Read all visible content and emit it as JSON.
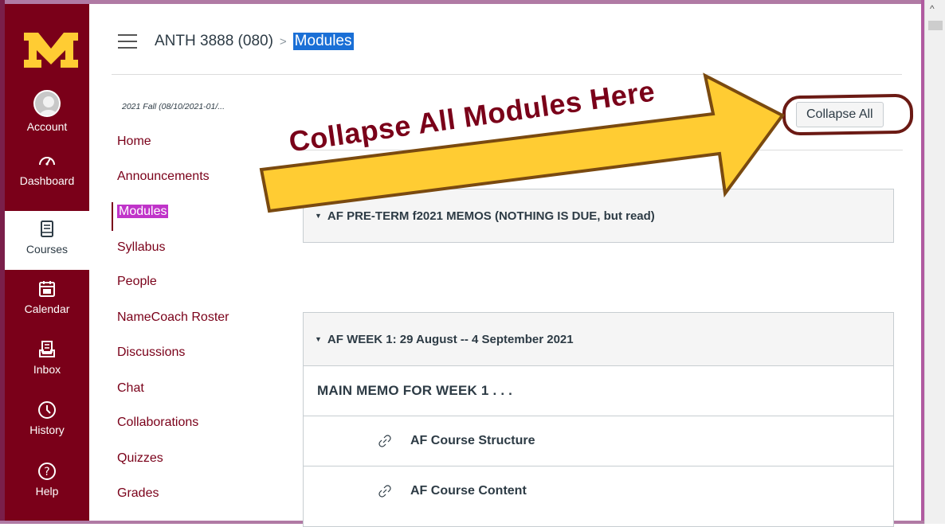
{
  "global_nav": {
    "items": [
      {
        "label": "Account",
        "icon": "avatar-icon"
      },
      {
        "label": "Dashboard",
        "icon": "dashboard-icon"
      },
      {
        "label": "Courses",
        "icon": "courses-icon",
        "active": true
      },
      {
        "label": "Calendar",
        "icon": "calendar-icon"
      },
      {
        "label": "Inbox",
        "icon": "inbox-icon"
      },
      {
        "label": "History",
        "icon": "history-icon"
      },
      {
        "label": "Help",
        "icon": "help-icon"
      }
    ]
  },
  "header": {
    "course": "ANTH 3888 (080)",
    "separator": ">",
    "current": "Modules"
  },
  "course_nav": {
    "term": "2021 Fall (08/10/2021-01/...",
    "items": [
      "Home",
      "Announcements",
      "Modules",
      "Syllabus",
      "People",
      "NameCoach Roster",
      "Discussions",
      "Chat",
      "Collaborations",
      "Quizzes",
      "Grades"
    ],
    "active": "Modules"
  },
  "toolbar": {
    "collapse_label": "Collapse All"
  },
  "annotation": {
    "text": "Collapse All Modules Here"
  },
  "modules": [
    {
      "title": "AF PRE-TERM f2021 MEMOS (NOTHING IS DUE, but read)"
    },
    {
      "title": "AF WEEK 1: 29 August -- 4 September 2021",
      "rows": [
        {
          "type": "header",
          "label": "MAIN MEMO FOR WEEK 1 . . ."
        },
        {
          "type": "link",
          "label": "AF Course Structure"
        },
        {
          "type": "link",
          "label": "AF Course Content"
        }
      ]
    }
  ],
  "colors": {
    "brand": "#7a0019",
    "gold": "#ffcc33",
    "highlight_current": "#1a6fd6",
    "highlight_active_nav": "#c034c9"
  }
}
